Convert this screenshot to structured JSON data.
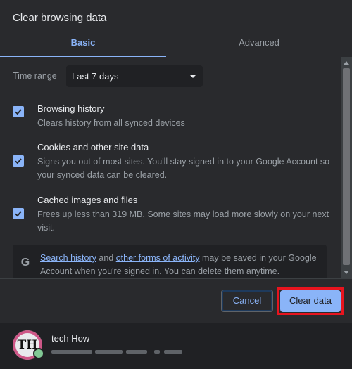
{
  "dialog": {
    "title": "Clear browsing data",
    "tabs": [
      {
        "label": "Basic",
        "selected": true
      },
      {
        "label": "Advanced",
        "selected": false
      }
    ]
  },
  "time_range": {
    "label": "Time range",
    "value": "Last 7 days"
  },
  "options": [
    {
      "title": "Browsing history",
      "description": "Clears history from all synced devices",
      "checked": true
    },
    {
      "title": "Cookies and other site data",
      "description": "Signs you out of most sites. You'll stay signed in to your Google Account so your synced data can be cleared.",
      "checked": true
    },
    {
      "title": "Cached images and files",
      "description": "Frees up less than 319 MB. Some sites may load more slowly on your next visit.",
      "checked": true
    }
  ],
  "info": {
    "icon": "google-g-icon",
    "link1": "Search history",
    "text1": " and ",
    "link2": "other forms of activity",
    "text2": " may be saved in your Google Account when you're signed in. You can delete them anytime."
  },
  "buttons": {
    "cancel": "Cancel",
    "clear": "Clear data"
  },
  "account": {
    "name": "tech How",
    "avatar_text": "TH",
    "email_redacted": true
  },
  "colors": {
    "accent": "#8ab4f8",
    "background": "#292a2d",
    "highlight_border": "#e8141e"
  }
}
